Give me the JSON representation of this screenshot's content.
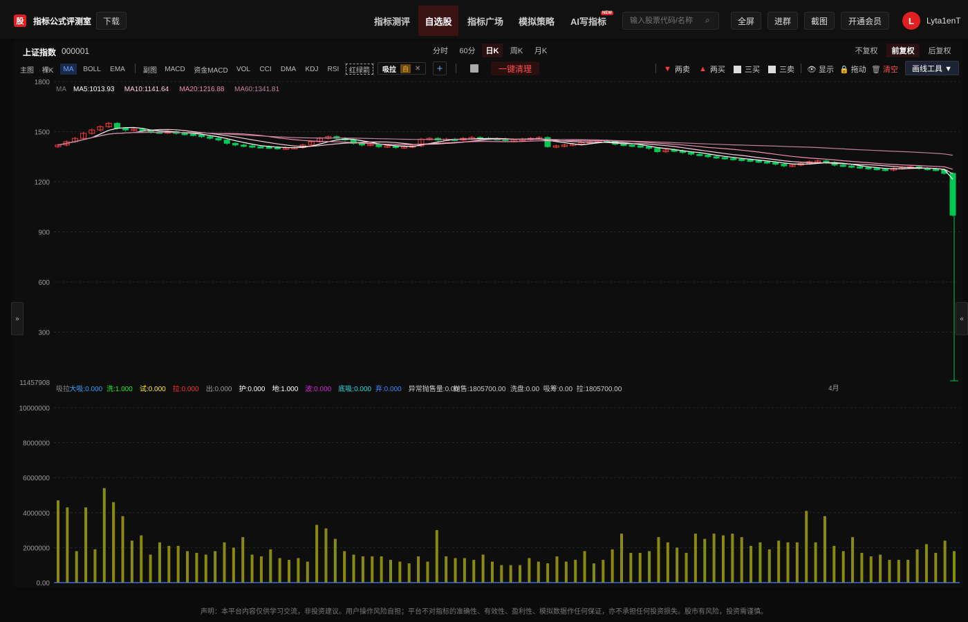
{
  "header": {
    "logo_char": "股",
    "brand": "指标公式评测室",
    "download": "下载",
    "nav": [
      "指标测评",
      "自选股",
      "指标广场",
      "模拟策略",
      "AI写指标"
    ],
    "new_badge": "NEW",
    "search_placeholder": "输入股票代码/名称",
    "buttons": [
      "全屏",
      "进群",
      "截图",
      "开通会员"
    ],
    "avatar_letter": "L",
    "username": "Lyta1enT"
  },
  "stock": {
    "name": "上证指数",
    "code": "000001"
  },
  "periods": [
    "分时",
    "60分",
    "日K",
    "周K",
    "月K"
  ],
  "adjust": [
    "不复权",
    "前复权",
    "后复权"
  ],
  "indicators_main": [
    "主图",
    "裸K",
    "MA",
    "BOLL",
    "EMA"
  ],
  "indicators_sub": [
    "副图",
    "MACD",
    "资金MACD",
    "VOL",
    "CCI",
    "DMA",
    "KDJ",
    "RSI",
    "红绿箭"
  ],
  "xila": {
    "label": "吸拉",
    "tag": "自"
  },
  "clear_label": "一键清理",
  "draw_tools": {
    "two_sell": "两卖",
    "two_buy": "两买",
    "three_buy": "三买",
    "three_sell": "三卖",
    "show": "显示",
    "drag": "拖动",
    "clear": "清空",
    "draw_tool": "画线工具 ▼"
  },
  "ma_legend": {
    "label": "MA",
    "ma5": "MA5:1013.93",
    "ma10": "MA10:1141.64",
    "ma20": "MA20:1216.88",
    "ma60": "MA60:1341.81"
  },
  "sub_legend": [
    {
      "t": "吸拉",
      "c": "#888"
    },
    {
      "t": "大吸:0.000",
      "c": "#2ea0ff"
    },
    {
      "t": "洗:1.000",
      "c": "#22ee22"
    },
    {
      "t": "试:0.000",
      "c": "#ffee22"
    },
    {
      "t": "拉:0.000",
      "c": "#ff3333"
    },
    {
      "t": "出:0.000",
      "c": "#999"
    },
    {
      "t": "护:0.000",
      "c": "#fff"
    },
    {
      "t": "地:1.000",
      "c": "#fff"
    },
    {
      "t": "波:0.000",
      "c": "#dd22dd"
    },
    {
      "t": "底吸:0.000",
      "c": "#22dddd"
    },
    {
      "t": "弃:0.000",
      "c": "#4488ff"
    },
    {
      "t": "异常抛售量:0.00",
      "c": "#ccc"
    },
    {
      "t": "抛售:1805700.00",
      "c": "#ccc"
    },
    {
      "t": "洗盘:0.00",
      "c": "#ccc"
    },
    {
      "t": "吸筹:0.00",
      "c": "#ccc"
    },
    {
      "t": "拉:1805700.00",
      "c": "#ccc"
    }
  ],
  "month_label": "4月",
  "disclaimer": "声明：本平台内容仅供学习交流，非投资建议。用户操作风险自担；平台不对指标的准确性、有效性、盈利性、模拟数据作任何保证，亦不承担任何投资损失。股市有风险，投资需谨慎。",
  "colors": {
    "up": "#ff3b3b",
    "down": "#00c853",
    "ma5": "#ffffff",
    "ma10": "#ffd0dc",
    "ma20": "#f08fb0",
    "ma60": "#c080a0",
    "vol": "#8a8a10"
  },
  "chart_data": {
    "type": "candlestick",
    "main_y_ticks": [
      1800,
      1500,
      1200,
      900,
      600,
      300
    ],
    "main_ylim": [
      0,
      1800
    ],
    "sub_y_ticks": [
      10000000,
      8000000,
      6000000,
      4000000,
      2000000,
      0
    ],
    "sub_y_tick_labels": [
      "10000000",
      "8000000",
      "6000000",
      "4000000",
      "2000000",
      "0.00"
    ],
    "sub_top_label": "11457908",
    "sub_ylim": [
      0,
      11457908
    ],
    "closes": [
      1420,
      1440,
      1460,
      1490,
      1510,
      1530,
      1550,
      1520,
      1510,
      1515,
      1505,
      1498,
      1495,
      1500,
      1490,
      1485,
      1480,
      1470,
      1460,
      1450,
      1430,
      1420,
      1415,
      1410,
      1408,
      1405,
      1400,
      1402,
      1405,
      1420,
      1440,
      1460,
      1470,
      1460,
      1450,
      1430,
      1420,
      1425,
      1410,
      1415,
      1405,
      1410,
      1415,
      1455,
      1460,
      1450,
      1455,
      1450,
      1460,
      1465,
      1460,
      1458,
      1455,
      1450,
      1450,
      1455,
      1460,
      1465,
      1410,
      1415,
      1420,
      1425,
      1435,
      1440,
      1445,
      1440,
      1425,
      1420,
      1415,
      1410,
      1400,
      1380,
      1390,
      1385,
      1375,
      1365,
      1360,
      1350,
      1345,
      1340,
      1335,
      1330,
      1325,
      1320,
      1315,
      1305,
      1295,
      1300,
      1310,
      1320,
      1325,
      1315,
      1300,
      1295,
      1290,
      1285,
      1280,
      1275,
      1270,
      1280,
      1285,
      1290,
      1280,
      1275,
      1270,
      1250,
      1000
    ],
    "volume_base": [
      4700000,
      4300000,
      1800000,
      4300000,
      1900000,
      5400000,
      4600000,
      3800000,
      2400000,
      2700000,
      1600000,
      2300000,
      2100000,
      2100000,
      1800000,
      1700000,
      1600000,
      1800000,
      2300000,
      2000000,
      2600000,
      1600000,
      1500000,
      1900000,
      1400000,
      1300000,
      1400000,
      1200000,
      3300000,
      3100000,
      2500000,
      1800000,
      1600000,
      1500000,
      1500000,
      1500000,
      1300000,
      1200000,
      1100000,
      1500000,
      1200000,
      3000000,
      1500000,
      1400000,
      1400000,
      1300000,
      1600000,
      1200000,
      1000000,
      1000000,
      1000000,
      1400000,
      1200000,
      1100000,
      1500000,
      1200000,
      1300000,
      1800000,
      1100000,
      1300000,
      1900000,
      2800000,
      1700000,
      1700000,
      1800000,
      2600000,
      2300000,
      2000000,
      1700000,
      2800000,
      2500000,
      2800000,
      2700000,
      2800000,
      2600000,
      2100000,
      2300000,
      1900000,
      2400000,
      2300000,
      2300000,
      4100000,
      2300000,
      3800000,
      2100000,
      1800000,
      2600000,
      1700000,
      1500000,
      1600000,
      1300000,
      1300000,
      1300000,
      1900000,
      2200000,
      1700000,
      2400000,
      1800000
    ]
  }
}
